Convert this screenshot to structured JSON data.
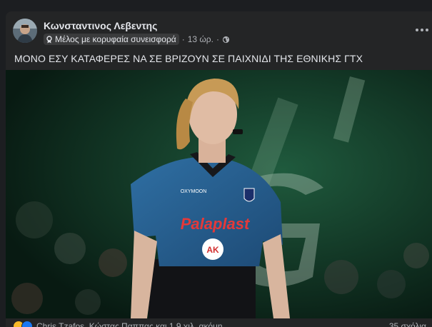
{
  "post": {
    "author_name": "Κωνσταντινος Λεβεντης",
    "badge_label": "Μέλος με κορυφαία συνεισφορά",
    "separator": "·",
    "timestamp": "13 ώρ.",
    "visibility_icon": "globe-icon",
    "text": "ΜΟΝΟ ΕΣΥ ΚΑΤΑΦΕΡΕΣ ΝΑ ΣΕ ΒΡΙΖΟΥΝ ΣΕ ΠΑΙΧΝΙΔΙ ΤΗΣ ΕΘΝΙΚΗΣ ΓΤΧ",
    "photo_jersey_text": "Palaplast",
    "photo_jersey_logo": "AK",
    "photo_brand_text": "OXYMOON"
  },
  "footer": {
    "reaction_names": "Chris Tzafos, Κώστας Παππας και 1,9 χιλ. ακόμη",
    "comments_count": "35 σχόλια"
  },
  "icons": {
    "badge": "badge-icon",
    "more": "more-options-icon",
    "reactions": [
      "haha-reaction-icon",
      "like-reaction-icon"
    ]
  },
  "colors": {
    "background": "#1c1e21",
    "card": "#242526",
    "text_primary": "#e4e6eb",
    "text_secondary": "#b0b3b8",
    "accent": "#1877f2"
  }
}
